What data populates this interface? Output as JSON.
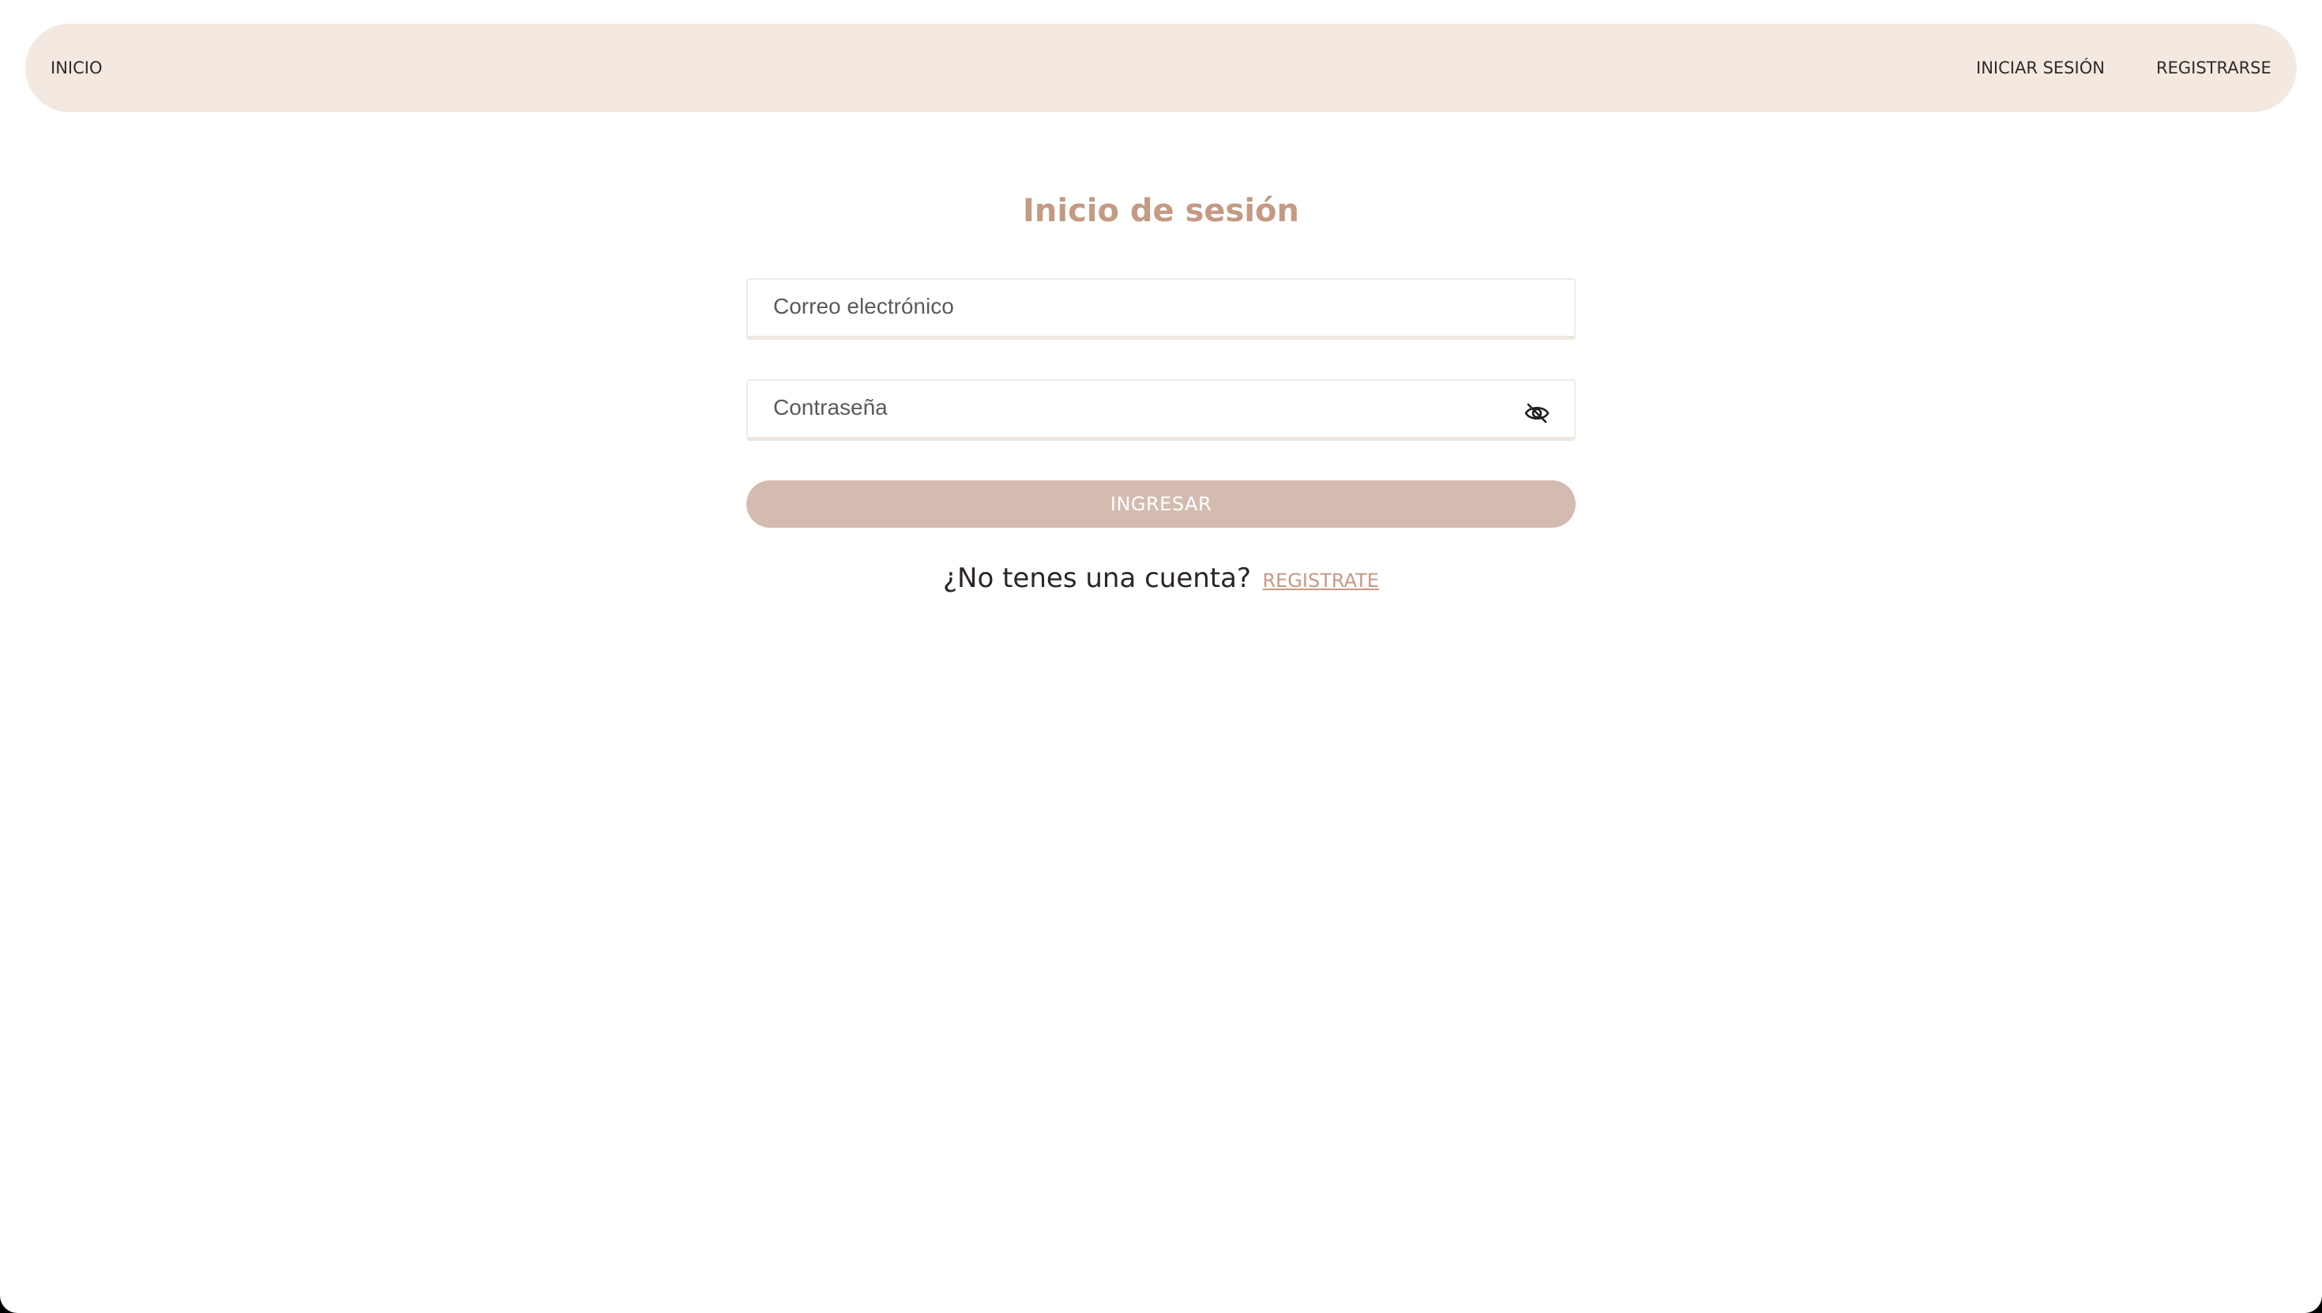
{
  "navbar": {
    "home_label": "INICIO",
    "login_label": "INICIAR SESIÓN",
    "register_label": "REGISTRARSE"
  },
  "login_form": {
    "title": "Inicio de sesión",
    "email_placeholder": "Correo electrónico",
    "email_value": "",
    "password_placeholder": "Contraseña",
    "password_value": "",
    "password_toggle_icon": "eye-off-icon",
    "submit_label": "INGRESAR",
    "no_account_text": "¿No tenes una cuenta?",
    "register_link_label": "REGISTRATE"
  },
  "colors": {
    "navbar_background": "#f3e9e0",
    "accent": "#c49a84",
    "button_background": "#d3bcaf",
    "button_text": "#ffffff",
    "text": "#2b2624"
  }
}
